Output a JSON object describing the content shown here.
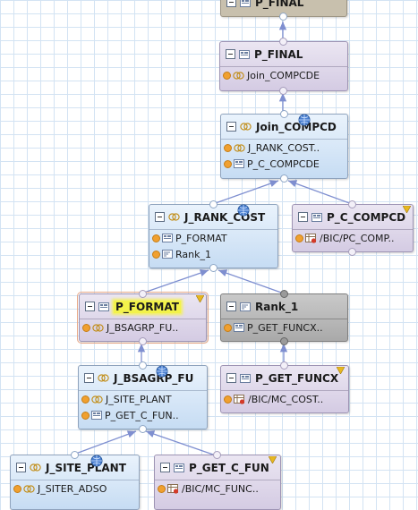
{
  "colors": {
    "edge": "#7f8fd0",
    "port": "#f0a030",
    "grid": "#d3e3f3"
  },
  "nodes": {
    "top_partial": {
      "title": "P_FINAL"
    },
    "p_final": {
      "title": "P_FINAL",
      "rows": [
        "Join_COMPCDE"
      ]
    },
    "join_compcd": {
      "title": "Join_COMPCD",
      "rows": [
        "J_RANK_COST..",
        "P_C_COMPCDE"
      ]
    },
    "j_rank_cost": {
      "title": "J_RANK_COST",
      "rows": [
        "P_FORMAT",
        "Rank_1"
      ]
    },
    "p_c_compcd": {
      "title": "P_C_COMPCD",
      "rows": [
        "/BIC/PC_COMP.."
      ]
    },
    "p_format": {
      "title": "P_FORMAT",
      "rows": [
        "J_BSAGRP_FU.."
      ]
    },
    "rank_1": {
      "title": "Rank_1",
      "rows": [
        "P_GET_FUNCX.."
      ]
    },
    "j_bsagrp_fu": {
      "title": "J_BSAGRP_FU",
      "rows": [
        "J_SITE_PLANT",
        "P_GET_C_FUN.."
      ]
    },
    "p_get_funcx": {
      "title": "P_GET_FUNCX",
      "rows": [
        "/BIC/MC_COST.."
      ]
    },
    "j_site_plant": {
      "title": "J_SITE_PLANT",
      "rows": [
        "J_SITER_ADSO"
      ]
    },
    "p_get_c_fun": {
      "title": "P_GET_C_FUN",
      "rows": [
        "/BIC/MC_FUNC.."
      ]
    }
  }
}
